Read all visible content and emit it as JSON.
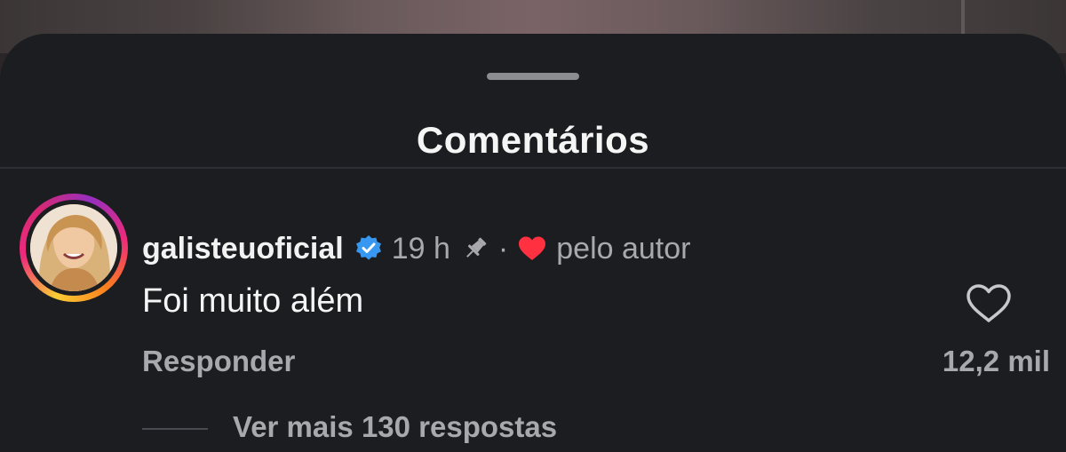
{
  "sheet": {
    "title": "Comentários"
  },
  "comment": {
    "username": "galisteuoficial",
    "verified": true,
    "time": "19 h",
    "pinned": true,
    "separator": "·",
    "liked_by_author_label": "pelo autor",
    "text": "Foi muito além",
    "reply_label": "Responder",
    "like_count": "12,2 mil",
    "view_replies_label": "Ver mais 130 respostas"
  },
  "colors": {
    "sheet_background": "#1c1d21",
    "primary_text": "#f5f5f5",
    "secondary_text": "#a8a8ad",
    "verified_blue": "#3897f0",
    "heart_red": "#ff3040"
  },
  "icons": {
    "verified": "verified-badge-icon",
    "pin": "pin-icon",
    "liked_by_author": "heart-filled-icon",
    "like": "heart-outline-icon"
  }
}
